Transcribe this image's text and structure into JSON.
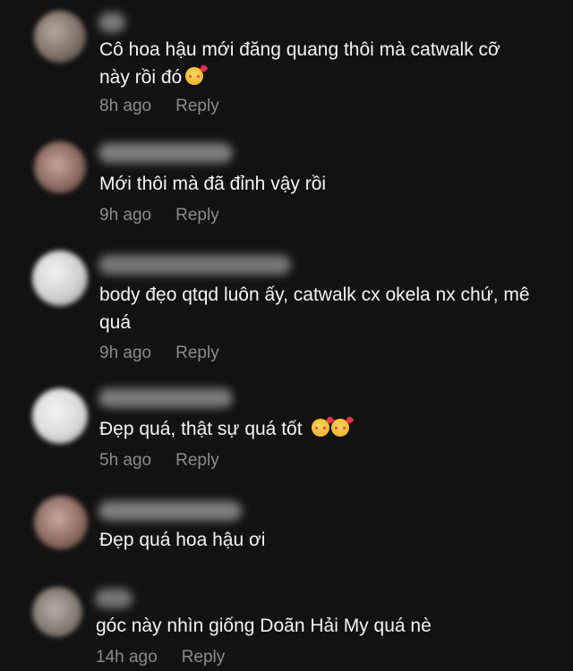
{
  "comments": [
    {
      "text_lines": [
        "Cô hoa hậu mới đăng quang thôi mà catwalk cỡ",
        "này rồi đó"
      ],
      "emoji_count": 1,
      "emoji": "smiling-face-with-hearts",
      "time": "8h ago",
      "reply": "Reply"
    },
    {
      "text_lines": [
        "Mới thôi mà đã đỉnh vậy rồi"
      ],
      "emoji_count": 0,
      "time": "9h ago",
      "reply": "Reply"
    },
    {
      "text_lines": [
        "body đẹo qtqd luôn ấy, catwalk cx okela nx chứ, mê",
        "quá"
      ],
      "emoji_count": 0,
      "time": "9h ago",
      "reply": "Reply"
    },
    {
      "text_lines": [
        "Đẹp quá, thật sự quá tốt"
      ],
      "emoji_count": 2,
      "emoji": "smiling-face-with-hearts",
      "time": "5h ago",
      "reply": "Reply"
    },
    {
      "text_lines": [
        "Đẹp quá hoa hậu ơi"
      ],
      "emoji_count": 0,
      "time": "",
      "reply": ""
    },
    {
      "text_lines": [
        "góc này nhìn giống Doãn Hải My quá nè"
      ],
      "emoji_count": 0,
      "time": "14h ago",
      "reply": "Reply"
    }
  ],
  "colors": {
    "background": "#121212",
    "text": "#f4f4f4",
    "meta": "#8b8b8b"
  }
}
